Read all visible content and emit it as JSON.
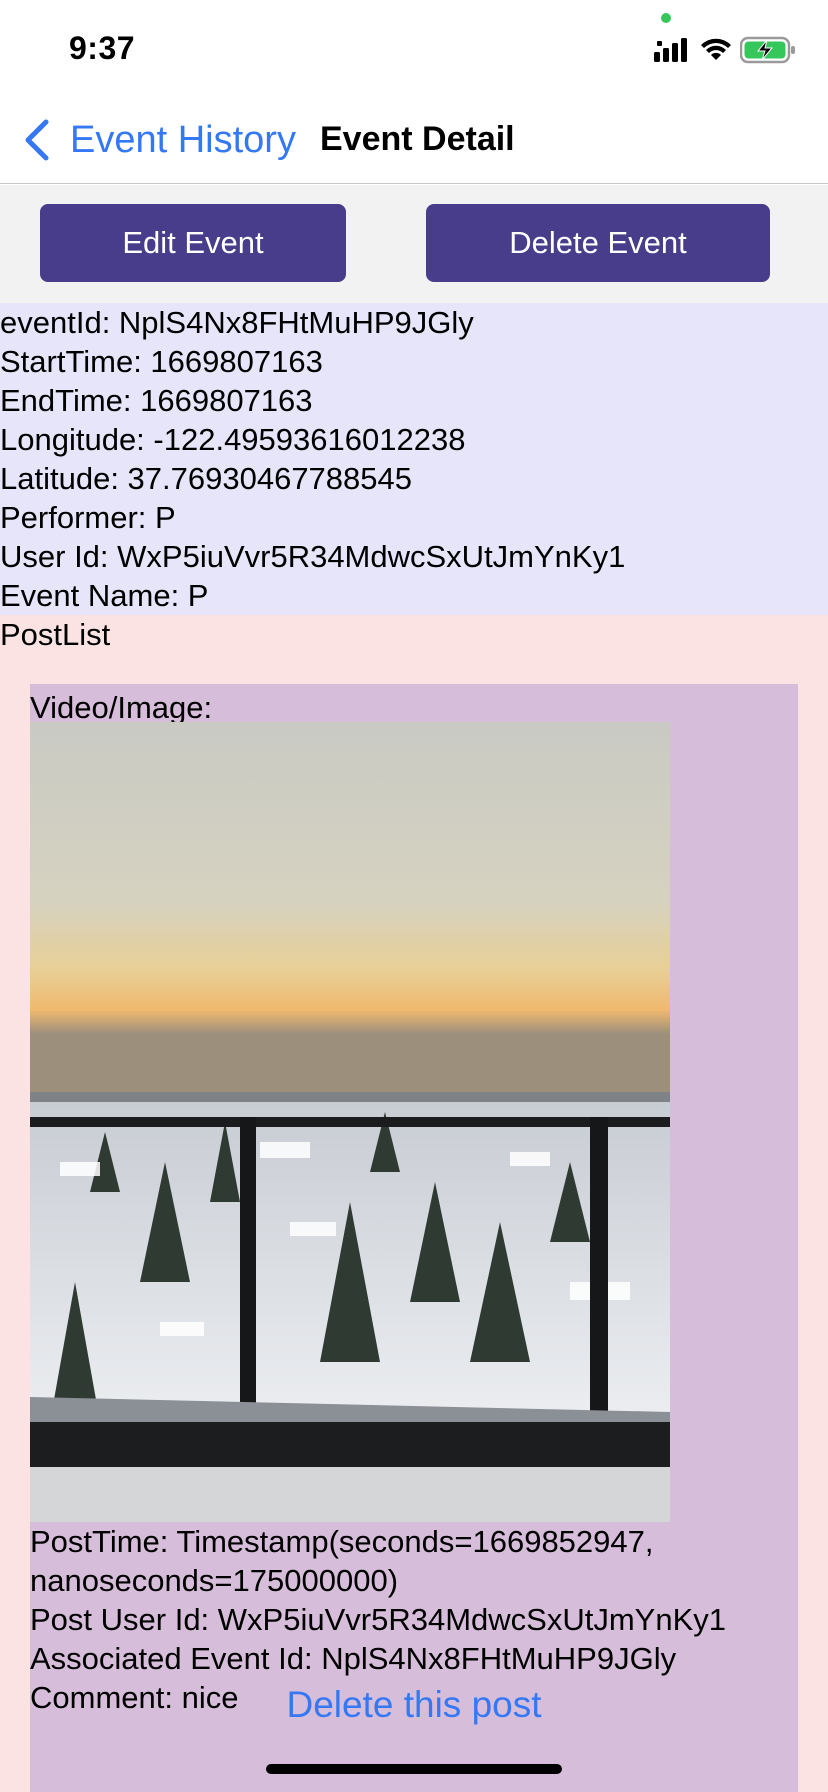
{
  "status_bar": {
    "time": "9:37",
    "icons": [
      "signal-icon",
      "wifi-icon",
      "battery-charging-icon"
    ],
    "privacy_dot_color": "#35c759"
  },
  "nav": {
    "back_label": "Event History",
    "title": "Event Detail",
    "back_icon": "chevron-left-icon",
    "accent_color": "#3478f6"
  },
  "actions": {
    "edit_label": "Edit Event",
    "delete_label": "Delete Event",
    "button_color": "#473d8b"
  },
  "event": {
    "event_id": "eventId: NplS4Nx8FHtMuHP9JGly",
    "start_time": "StartTime: 1669807163",
    "end_time": "EndTime: 1669807163",
    "longitude": "Longitude: -122.49593616012238",
    "latitude": "Latitude: 37.76930467788545",
    "performer": "Performer: P",
    "user_id": "User Id: WxP5iuVvr5R34MdwcSxUtJmYnKy1",
    "event_name": "Event Name: P"
  },
  "post_list": {
    "label": "PostList",
    "posts": [
      {
        "media_label": "Video/Image:",
        "post_time": "PostTime: Timestamp(seconds=1669852947,",
        "post_time_cont": "nanoseconds=175000000)",
        "post_user_id": "Post User Id: WxP5iuVvr5R34MdwcSxUtJmYnKy1",
        "associated_event_id": "Associated Event Id: NplS4Nx8FHtMuHP9JGly",
        "comment": "Comment: nice",
        "delete_label": "Delete this post"
      }
    ]
  },
  "colors": {
    "event_info_bg": "#e6e5f9",
    "post_section_bg": "#fae3e2",
    "post_card_bg": "#d6bdd9"
  }
}
